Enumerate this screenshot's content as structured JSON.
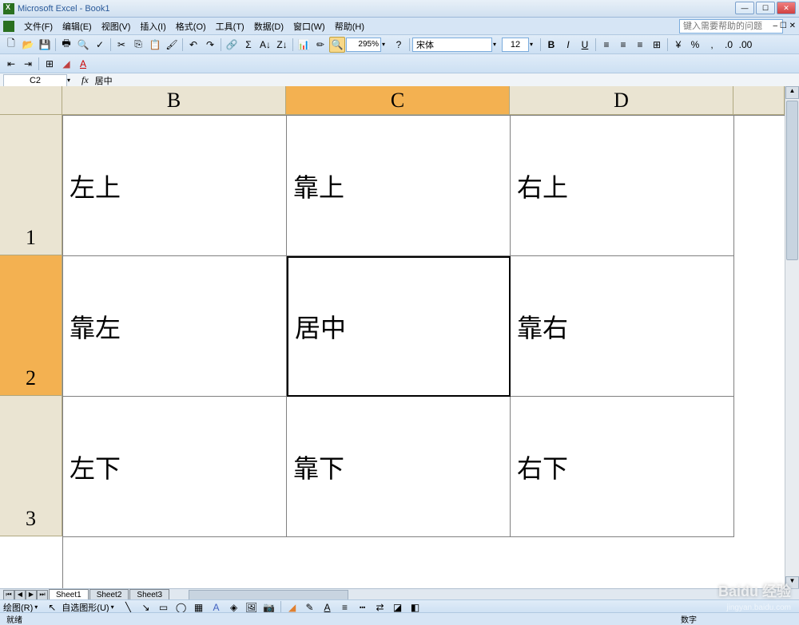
{
  "title": "Microsoft Excel - Book1",
  "menus": [
    "文件(F)",
    "编辑(E)",
    "视图(V)",
    "插入(I)",
    "格式(O)",
    "工具(T)",
    "数据(D)",
    "窗口(W)",
    "帮助(H)"
  ],
  "help_placeholder": "键入需要帮助的问题",
  "zoom": "295%",
  "font_name": "宋体",
  "font_size": "12",
  "name_box": "C2",
  "fx": "fx",
  "formula_value": "居中",
  "col_headers": [
    "B",
    "C",
    "D"
  ],
  "row_headers": [
    "1",
    "2",
    "3"
  ],
  "selected_col": 1,
  "selected_row": 1,
  "cells": [
    [
      "左上",
      "靠上",
      "右上"
    ],
    [
      "靠左",
      "居中",
      "靠右"
    ],
    [
      "左下",
      "靠下",
      "右下"
    ]
  ],
  "sheet_tabs": [
    "Sheet1",
    "Sheet2",
    "Sheet3"
  ],
  "active_tab": 0,
  "draw_label": "绘图(R)",
  "autoshape_label": "自选图形(U)",
  "status_left": "就绪",
  "status_right": "数字",
  "watermark": "Baidu 经验",
  "watermark_sub": "jingyan.baidu.com"
}
